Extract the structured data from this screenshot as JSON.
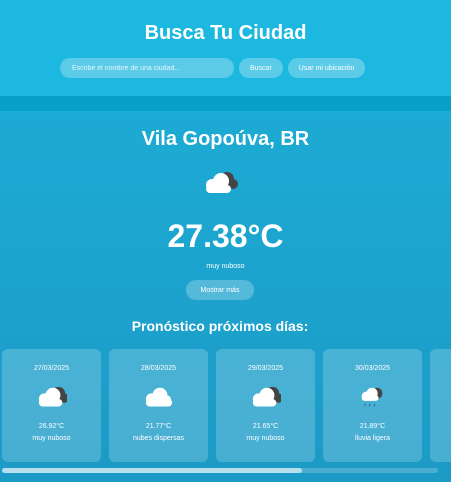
{
  "header": {
    "title": "Busca Tu Ciudad",
    "search_placeholder": "Escribe el nombre de una ciudad...",
    "search_button": "Buscar",
    "location_button": "Usar mi ubicación"
  },
  "current": {
    "city": "Vila Gopoúva, BR",
    "icon": "broken-clouds-icon",
    "temperature": "27.38°C",
    "description": "muy nuboso",
    "more_button": "Mostrar más"
  },
  "forecast": {
    "title": "Pronóstico próximos días:",
    "days": [
      {
        "date": "27/03/2025",
        "icon": "broken-clouds-icon",
        "temp": "26.92°C",
        "desc": "muy nuboso"
      },
      {
        "date": "28/03/2025",
        "icon": "cloud-icon",
        "temp": "21.77°C",
        "desc": "nubes dispersas"
      },
      {
        "date": "29/03/2025",
        "icon": "broken-clouds-icon",
        "temp": "21.65°C",
        "desc": "muy nuboso"
      },
      {
        "date": "30/03/2025",
        "icon": "rain-cloud-icon",
        "temp": "21.89°C",
        "desc": "lluvia ligera"
      }
    ]
  },
  "colors": {
    "background": "#1aa9d2",
    "header": "#1db8e0",
    "band": "#08a0c9"
  }
}
